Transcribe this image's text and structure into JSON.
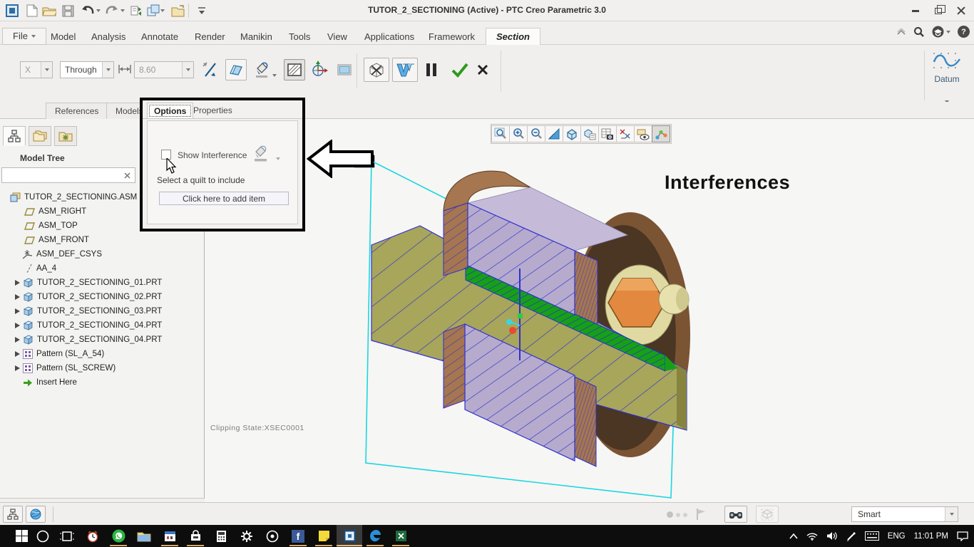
{
  "window": {
    "title": "TUTOR_2_SECTIONING (Active) - PTC Creo Parametric 3.0",
    "controls": [
      "minimize",
      "restore",
      "close"
    ]
  },
  "quick_access_icons": [
    "app-logo",
    "new-file",
    "open-file",
    "save",
    "undo",
    "redo",
    "regenerate",
    "windows",
    "new-folder",
    "customize-toolbar"
  ],
  "ribbon": {
    "tabs": [
      "File",
      "Model",
      "Analysis",
      "Annotate",
      "Render",
      "Manikin",
      "Tools",
      "View",
      "Applications",
      "Framework",
      "Section"
    ],
    "active_tab": "Section",
    "right_icons": [
      "collapse-ribbon",
      "search",
      "learning-connector",
      "help"
    ],
    "help_glyph": "?"
  },
  "dashboard": {
    "axis_label": "X",
    "depth_option": "Through",
    "depth_value": "8.60",
    "icons": [
      "flip-direction",
      "section-plane",
      "hatch-fill-bucket",
      "hatch-pattern",
      "orient-axis",
      "preview-rect",
      "interference-wireframe",
      "interference-shaded",
      "pause",
      "accept",
      "cancel"
    ],
    "datum_label": "Datum",
    "panel_tabs": [
      "References",
      "Models"
    ]
  },
  "options_panel": {
    "tabs": [
      "Options",
      "Properties"
    ],
    "active_tab": "Options",
    "show_interference_label": "Show Interference",
    "show_interference_checked": false,
    "quilt_prompt": "Select a quilt to include",
    "add_item_label": "Click here to add item"
  },
  "navigator": {
    "title": "Model Tree",
    "search_value": "",
    "header_icons": [
      "model-tree-view",
      "folder-browser",
      "favorites"
    ],
    "tree": [
      {
        "label": "TUTOR_2_SECTIONING.ASM",
        "icon": "assembly"
      },
      {
        "label": "ASM_RIGHT",
        "icon": "datum-plane"
      },
      {
        "label": "ASM_TOP",
        "icon": "datum-plane"
      },
      {
        "label": "ASM_FRONT",
        "icon": "datum-plane"
      },
      {
        "label": "ASM_DEF_CSYS",
        "icon": "csys"
      },
      {
        "label": "AA_4",
        "icon": "axis"
      },
      {
        "label": "TUTOR_2_SECTIONING_01.PRT",
        "icon": "part",
        "expandable": true
      },
      {
        "label": "TUTOR_2_SECTIONING_02.PRT",
        "icon": "part",
        "expandable": true
      },
      {
        "label": "TUTOR_2_SECTIONING_03.PRT",
        "icon": "part",
        "expandable": true
      },
      {
        "label": "TUTOR_2_SECTIONING_04.PRT",
        "icon": "part",
        "expandable": true
      },
      {
        "label": "TUTOR_2_SECTIONING_04.PRT",
        "icon": "part",
        "expandable": true
      },
      {
        "label": "Pattern (SL_A_54)",
        "icon": "pattern",
        "expandable": true
      },
      {
        "label": "Pattern (SL_SCREW)",
        "icon": "pattern",
        "expandable": true
      },
      {
        "label": "Insert Here",
        "icon": "insert-arrow"
      }
    ]
  },
  "graphics": {
    "annotation": "Interferences",
    "clipping_state": "Clipping State:XSEC0001",
    "toolbar_icons": [
      "zoom-region",
      "zoom-in",
      "zoom-out",
      "refit",
      "display-style",
      "saved-orientations",
      "view-manager",
      "datum-display-filters",
      "annotation-display",
      "spin-center"
    ],
    "active_toolbar_icon": "spin-center"
  },
  "status_bar": {
    "left_icons": [
      "toggle-model-tree",
      "toggle-browser"
    ],
    "right_icons": [
      "progress-dots",
      "flag",
      "find",
      "box-select"
    ],
    "filter_label": "Smart"
  },
  "taskbar": {
    "icons": [
      "start",
      "cortana",
      "task-view",
      "alarms",
      "whatsapp",
      "file-explorer",
      "calendar",
      "store",
      "calculator",
      "settings",
      "office",
      "facebook",
      "sticky-notes",
      "creo",
      "edge",
      "excel"
    ],
    "active_icon": "creo",
    "facebook_glyph": "f",
    "language": "ENG",
    "time": "11:01 PM"
  },
  "colors": {
    "section_plane": "#19d7e0",
    "block_hatch_fill": "#b6abcc",
    "hatch_line": "#2e2ed2",
    "shaft_fill": "#a8a65a",
    "interference_green": "#17a017",
    "hub_brown": "#a5764f",
    "flange_dark": "#4a3622",
    "nut_orange": "#e2893f",
    "bolt_cream": "#e7e1ad",
    "run_indicator": "#d9a866"
  }
}
